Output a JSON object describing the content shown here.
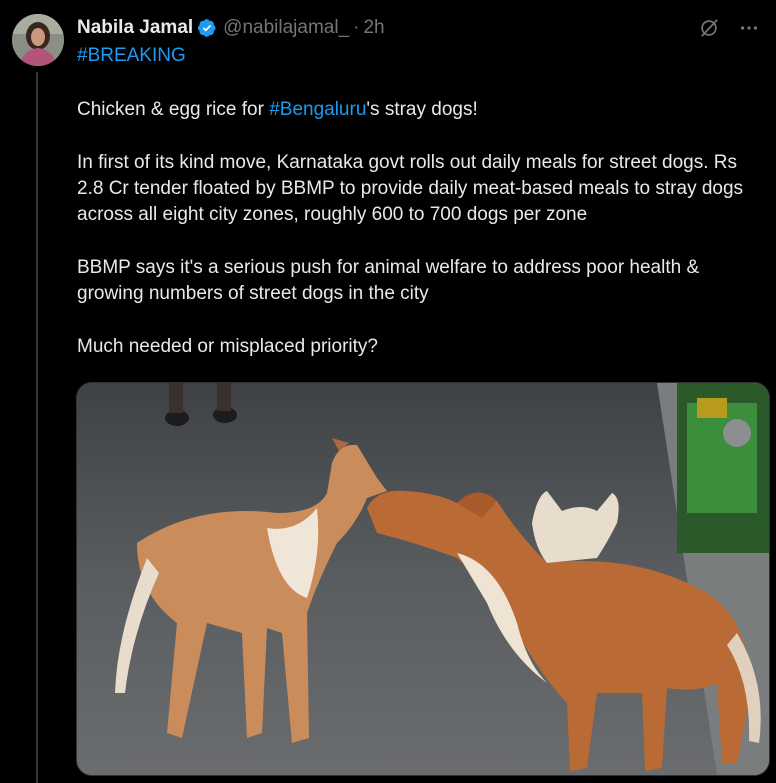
{
  "tweet": {
    "author_name": "Nabila Jamal",
    "handle": "@nabilajamal_",
    "separator": "·",
    "time": "2h",
    "hashtag": "#BREAKING",
    "line1_prefix": "Chicken & egg rice for ",
    "line1_link": "#Bengaluru",
    "line1_suffix": "'s stray dogs!",
    "paragraph2": "In first of its kind move, Karnataka govt rolls out daily meals for street dogs. Rs 2.8 Cr tender floated by BBMP to provide daily meat-based meals to stray dogs across all eight city zones, roughly 600 to 700 dogs per zone",
    "paragraph3": "BBMP says it's a serious push for animal welfare to address poor health & growing numbers of street dogs in the city",
    "paragraph4": "Much needed or misplaced priority?"
  },
  "icons": {
    "verified": "verified-badge-icon",
    "grok": "grok-slash-icon",
    "more": "more-dots-icon"
  },
  "colors": {
    "background": "#000000",
    "text": "#e7e9ea",
    "muted": "#71767b",
    "link": "#1d9bf0"
  }
}
